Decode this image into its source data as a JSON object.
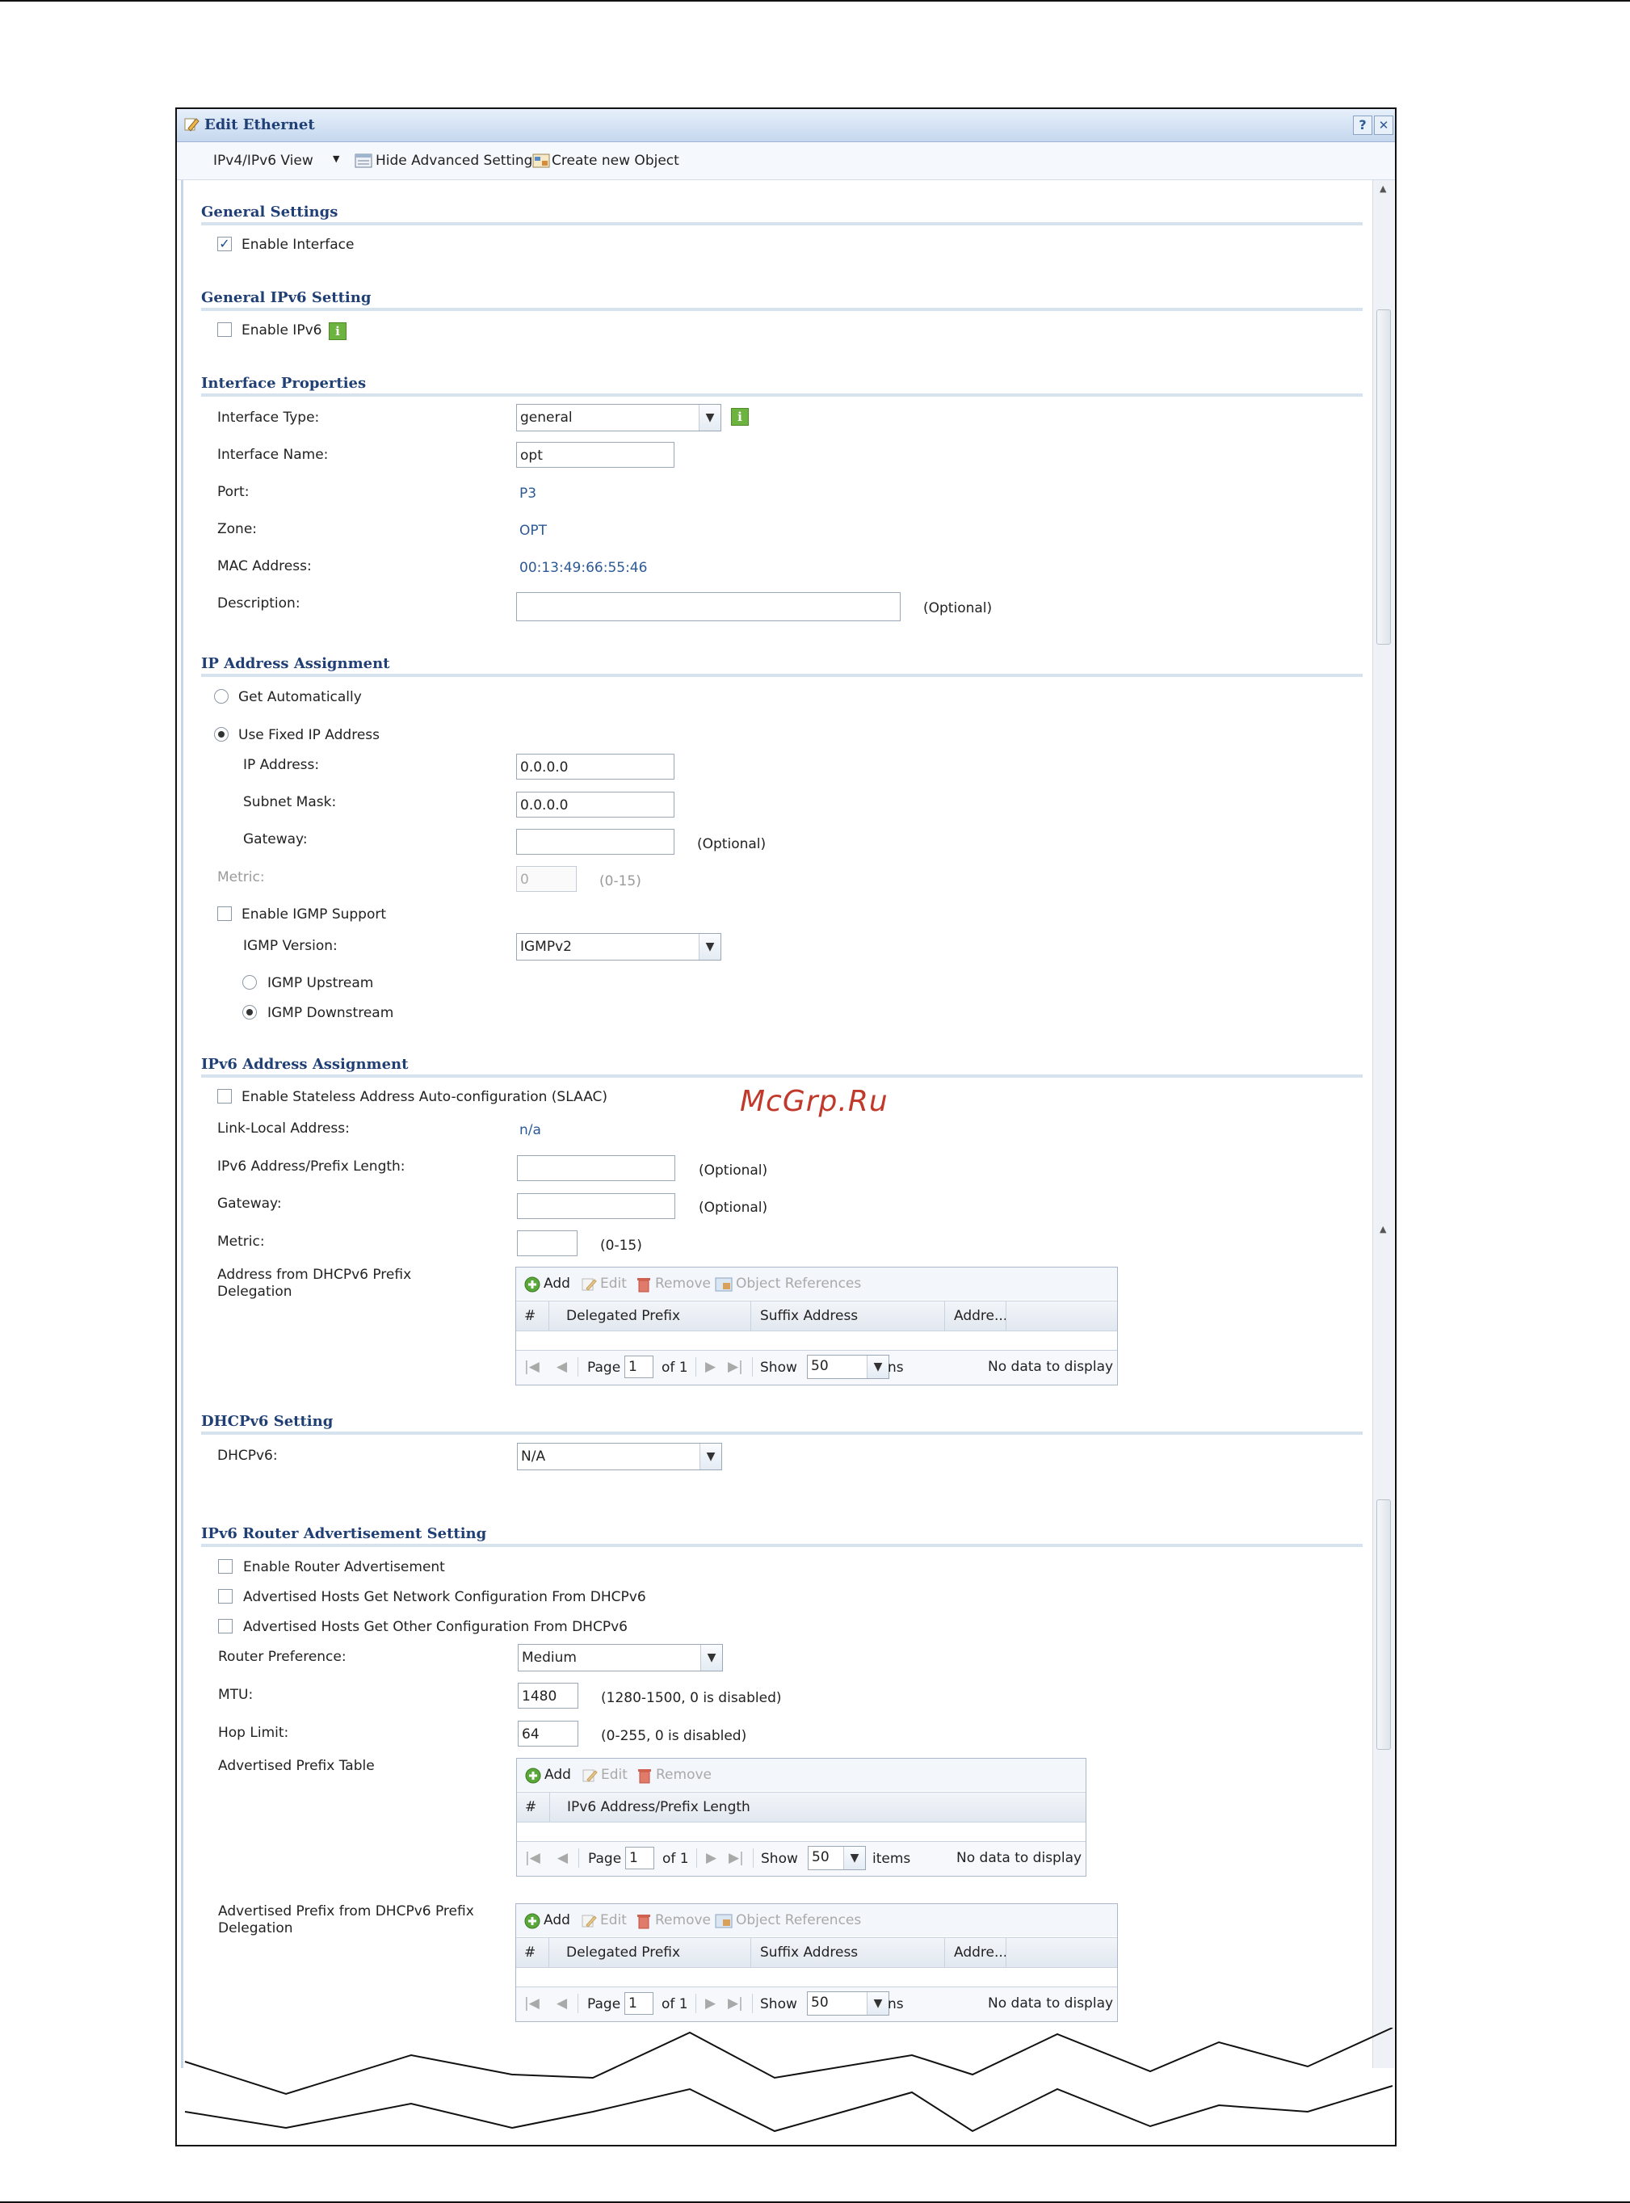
{
  "window": {
    "title": "Edit Ethernet",
    "help": "?",
    "close": "✕"
  },
  "toolbar": {
    "view": "IPv4/IPv6 View",
    "view_arrow": "▼",
    "hide_advanced": "Hide Advanced Settings",
    "create_object": "Create new Object"
  },
  "general": {
    "title": "General Settings",
    "enable_interface": "Enable Interface",
    "enable_interface_checked": true
  },
  "general_ipv6": {
    "title": "General IPv6 Setting",
    "enable_ipv6": "Enable IPv6",
    "enable_ipv6_checked": false
  },
  "interface": {
    "title": "Interface Properties",
    "type_label": "Interface Type:",
    "type_value": "general",
    "name_label": "Interface Name:",
    "name_value": "opt",
    "port_label": "Port:",
    "port_value": "P3",
    "zone_label": "Zone:",
    "zone_value": "OPT",
    "mac_label": "MAC Address:",
    "mac_value": "00:13:49:66:55:46",
    "desc_label": "Description:",
    "desc_value": "",
    "desc_hint": "(Optional)"
  },
  "ip": {
    "title": "IP Address Assignment",
    "get_auto": "Get Automatically",
    "use_fixed": "Use Fixed IP Address",
    "selected": "use_fixed",
    "ip_label": "IP Address:",
    "ip_value": "0.0.0.0",
    "mask_label": "Subnet Mask:",
    "mask_value": "0.0.0.0",
    "gw_label": "Gateway:",
    "gw_value": "",
    "gw_hint": "(Optional)",
    "metric_label": "Metric:",
    "metric_value": "0",
    "metric_hint": "(0-15)",
    "igmp_support": "Enable IGMP Support",
    "igmp_support_checked": false,
    "igmp_version_label": "IGMP Version:",
    "igmp_version_value": "IGMPv2",
    "igmp_upstream": "IGMP Upstream",
    "igmp_downstream": "IGMP Downstream",
    "igmp_selected": "downstream"
  },
  "ipv6": {
    "title": "IPv6 Address Assignment",
    "slaac": "Enable Stateless Address Auto-configuration (SLAAC)",
    "link_local_label": "Link-Local Address:",
    "link_local_value": "n/a",
    "prefix_label": "IPv6 Address/Prefix Length:",
    "prefix_hint": "(Optional)",
    "gw_label": "Gateway:",
    "gw_hint": "(Optional)",
    "metric_label": "Metric:",
    "metric_hint": "(0-15)",
    "deleg_label_1": "Address from DHCPv6 Prefix",
    "deleg_label_2": "Delegation"
  },
  "grid_common": {
    "add": "Add",
    "edit": "Edit",
    "remove": "Remove",
    "obj_refs": "Object References",
    "page": "Page",
    "page_value": "1",
    "of": "of 1",
    "show": "Show",
    "show_value": "50",
    "ns": "ns",
    "items": "items",
    "no_data": "No data to display",
    "col_num": "#",
    "col_deleg": "Delegated Prefix",
    "col_suffix": "Suffix Address",
    "col_addr": "Addre...",
    "col_ipv6": "IPv6 Address/Prefix Length"
  },
  "dhcpv6": {
    "title": "DHCPv6 Setting",
    "label": "DHCPv6:",
    "value": "N/A"
  },
  "ra": {
    "title": "IPv6 Router Advertisement Setting",
    "enable_ra": "Enable Router Advertisement",
    "hosts_network": "Advertised Hosts Get Network Configuration From DHCPv6",
    "hosts_other": "Advertised Hosts Get Other Configuration From DHCPv6",
    "pref_label": "Router Preference:",
    "pref_value": "Medium",
    "mtu_label": "MTU:",
    "mtu_value": "1480",
    "mtu_hint": "(1280-1500, 0 is disabled)",
    "hop_label": "Hop Limit:",
    "hop_value": "64",
    "hop_hint": "(0-255, 0 is disabled)",
    "prefix_table_label": "Advertised Prefix Table",
    "prefix_deleg_label_1": "Advertised Prefix from DHCPv6 Prefix",
    "prefix_deleg_label_2": "Delegation"
  },
  "watermark": "McGrp.Ru"
}
